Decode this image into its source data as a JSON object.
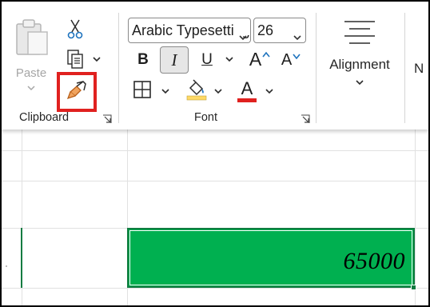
{
  "ribbon": {
    "clipboard": {
      "group_label": "Clipboard",
      "paste_label": "Paste",
      "cut_icon": "scissors-icon",
      "copy_icon": "copy-icon",
      "format_painter_icon": "paintbrush-icon",
      "highlight_color": "#e0211f"
    },
    "font": {
      "group_label": "Font",
      "font_name": "Arabic Typesetting",
      "font_size": "26",
      "bold_label": "B",
      "italic_label": "I",
      "underline_label": "U",
      "grow_label": "A",
      "shrink_label": "A",
      "font_color_label": "A",
      "font_color": "#e0211f",
      "fill_color": "#ffd966",
      "italic_active": true
    },
    "alignment": {
      "label": "Alignment"
    },
    "number": {
      "label_partial": "N"
    }
  },
  "sheet": {
    "selected_cell_value": "65000",
    "selected_cell_fill": "#00b050"
  }
}
